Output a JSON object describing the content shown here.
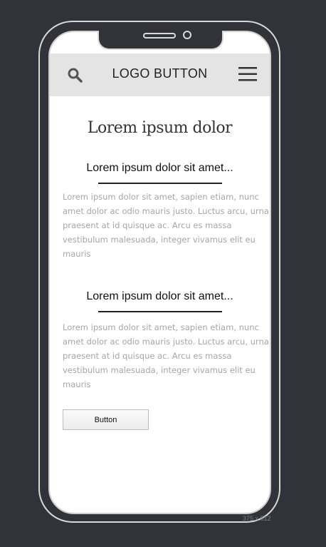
{
  "header": {
    "logo_label": "LOGO BUTTON",
    "search_icon": "search-icon",
    "menu_icon": "hamburger-menu-icon"
  },
  "main": {
    "title": "Lorem ipsum dolor",
    "sections": [
      {
        "heading": "Lorem ipsum dolor sit amet...",
        "body": "Lorem ipsum dolor sit amet, sapien etiam, nunc amet dolor ac odio mauris justo. Luctus arcu, urna praesent at id quisque ac. Arcu es massa vestibulum malesuada, integer vivamus elit eu mauris"
      },
      {
        "heading": "Lorem ipsum dolor sit amet...",
        "body": "Lorem ipsum dolor sit amet, sapien etiam, nunc amet dolor ac odio mauris justo. Luctus arcu, urna praesent at id quisque ac. Arcu es massa vestibulum malesuada, integer vivamus elit eu mauris"
      }
    ],
    "button_label": "Button"
  },
  "frame": {
    "size_label": "375 x 812"
  },
  "colors": {
    "background": "#323338",
    "header_bg": "#e4e4e4",
    "body_text": "#a6a6a6"
  }
}
